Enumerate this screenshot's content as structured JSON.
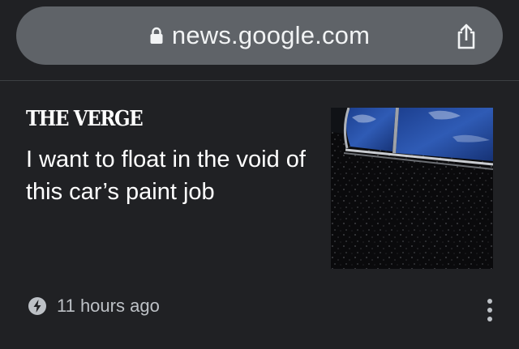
{
  "browser": {
    "url": "news.google.com",
    "lock_icon": "lock-icon",
    "share_icon": "share-icon"
  },
  "article": {
    "publisher": "THE VERGE",
    "headline": "I want to float in the void of this car’s paint job",
    "timestamp": "11 hours ago",
    "timestamp_icon": "bolt-icon",
    "menu_icon": "more-vert-icon",
    "thumbnail": "car-window-black-paint-image"
  },
  "colors": {
    "background": "#202124",
    "urlbar": "#5f6368",
    "text_primary": "#ffffff",
    "text_secondary": "#bdc1c6"
  }
}
